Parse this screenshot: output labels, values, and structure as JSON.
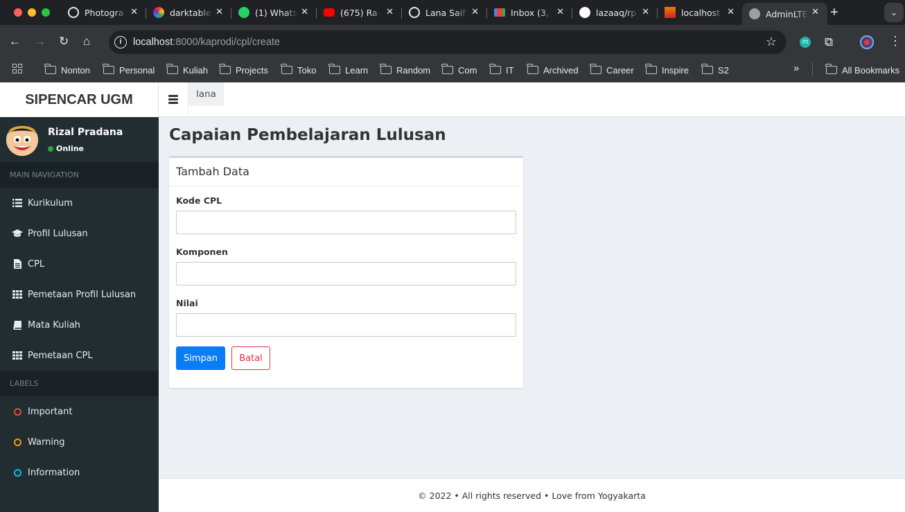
{
  "browser": {
    "tabs": [
      {
        "title": "Photogra",
        "favicon_color": "#e8eaed"
      },
      {
        "title": "darktable",
        "favicon_color": "#c2185b"
      },
      {
        "title": "(1) Whats",
        "favicon_color": "#25d366"
      },
      {
        "title": "(675) Ra",
        "favicon_color": "#ff0000"
      },
      {
        "title": "Lana Saif",
        "favicon_color": "#202124"
      },
      {
        "title": "Inbox (3,",
        "favicon_color": "#ea4335"
      },
      {
        "title": "lazaaq/rp",
        "favicon_color": "#ffffff"
      },
      {
        "title": "localhost",
        "favicon_color": "#f57c00"
      },
      {
        "title": "AdminLTE",
        "favicon_color": "#9aa0a6"
      }
    ],
    "url_host": "localhost",
    "url_rest": ":8000/kaprodi/cpl/create",
    "bookmarks": [
      "Nonton",
      "Personal",
      "Kuliah",
      "Projects",
      "Toko",
      "Learn",
      "Random",
      "Com",
      "IT",
      "Archived",
      "Career",
      "Inspire",
      "S2"
    ],
    "all_bookmarks": "All Bookmarks",
    "profile_letter": "m"
  },
  "app": {
    "brand": "SIPENCAR UGM",
    "top_tab": "lana",
    "user": {
      "name": "Rizal Pradana",
      "status": "Online"
    },
    "sections": {
      "main": "MAIN NAVIGATION",
      "labels": "LABELS"
    },
    "nav": [
      {
        "label": "Kurikulum",
        "icon": "list-icon"
      },
      {
        "label": "Profil Lulusan",
        "icon": "graduation-cap-icon"
      },
      {
        "label": "CPL",
        "icon": "file-icon"
      },
      {
        "label": "Pemetaan Profil Lulusan",
        "icon": "grid-icon"
      },
      {
        "label": "Mata Kuliah",
        "icon": "book-icon"
      },
      {
        "label": "Pemetaan CPL",
        "icon": "grid-icon"
      }
    ],
    "labels": [
      {
        "label": "Important",
        "color": "#dd4b39"
      },
      {
        "label": "Warning",
        "color": "#f39c12"
      },
      {
        "label": "Information",
        "color": "#00c0ef"
      }
    ],
    "page_title": "Capaian Pembelajaran Lulusan",
    "form": {
      "title": "Tambah Data",
      "fields": [
        {
          "label": "Kode CPL",
          "value": "",
          "placeholder": ""
        },
        {
          "label": "Komponen",
          "value": "",
          "placeholder": ""
        },
        {
          "label": "Nilai",
          "value": "",
          "placeholder": ""
        }
      ],
      "submit": "Simpan",
      "cancel": "Batal"
    },
    "footer": "© 2022 • All rights reserved • Love from Yogyakarta"
  }
}
